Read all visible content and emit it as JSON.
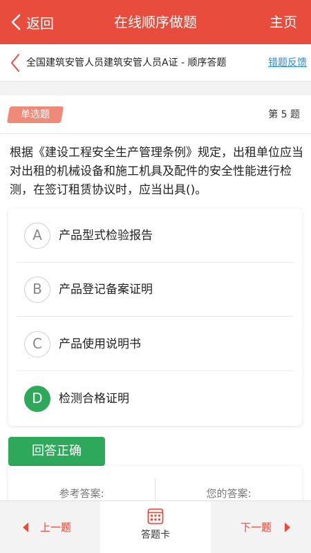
{
  "header": {
    "back_label": "返回",
    "title": "在线顺序做题",
    "home_label": "主页",
    "color": "#e74c3c"
  },
  "breadcrumb": {
    "title": "全国建筑安管人员建筑安管人员A证 - 顺序答题",
    "feedback_label": "错题反馈"
  },
  "question": {
    "type": "单选题",
    "number_label": "第 5 题",
    "text": "根据《建设工程安全生产管理条例》规定，出租单位应当对出租的机械设备和施工机具及配件的安全性能进行检测，在签订租赁协议时，应当出具()。",
    "options": [
      {
        "letter": "A",
        "text": "产品型式检验报告"
      },
      {
        "letter": "B",
        "text": "产品登记备案证明"
      },
      {
        "letter": "C",
        "text": "产品使用说明书"
      },
      {
        "letter": "D",
        "text": "检测合格证明"
      }
    ],
    "correct_option": "D"
  },
  "result": {
    "label": "回答正确",
    "color": "#2ea85a",
    "reference_label": "参考答案:",
    "your_label": "您的答案:"
  },
  "footer": {
    "prev_label": "上一题",
    "card_label": "答题卡",
    "next_label": "下一题",
    "card_icon": "grid-icon"
  }
}
